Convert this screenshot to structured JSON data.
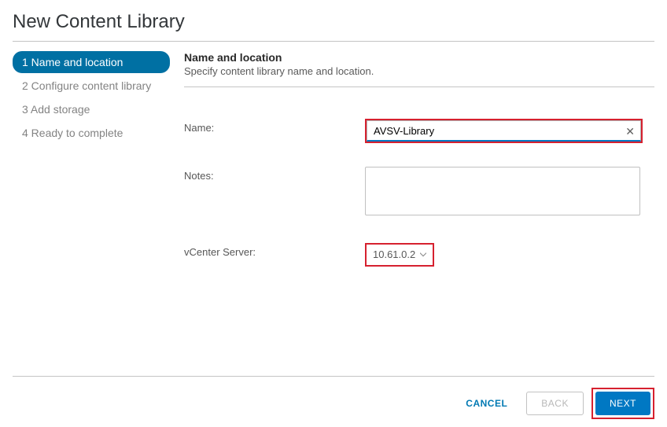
{
  "dialog": {
    "title": "New Content Library"
  },
  "sidebar": {
    "items": [
      {
        "label": "1 Name and location",
        "active": true
      },
      {
        "label": "2 Configure content library",
        "active": false
      },
      {
        "label": "3 Add storage",
        "active": false
      },
      {
        "label": "4 Ready to complete",
        "active": false
      }
    ]
  },
  "content": {
    "heading": "Name and location",
    "subtitle": "Specify content library name and location.",
    "name_label": "Name:",
    "name_value": "AVSV-Library",
    "notes_label": "Notes:",
    "notes_value": "",
    "vcenter_label": "vCenter Server:",
    "vcenter_value": "10.61.0.2"
  },
  "footer": {
    "cancel": "CANCEL",
    "back": "BACK",
    "next": "NEXT"
  }
}
